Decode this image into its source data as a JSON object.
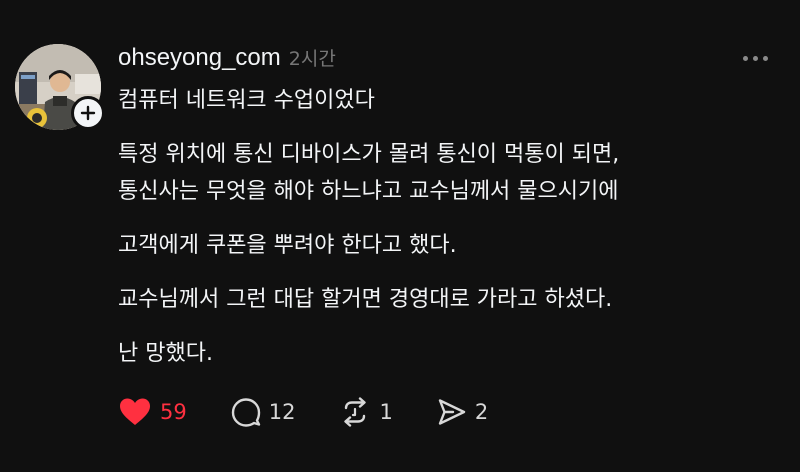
{
  "post": {
    "username": "ohseyong_com",
    "time": "2시간",
    "lines": [
      "컴퓨터 네트워크 수업이었다",
      "특정 위치에 통신 디바이스가 몰려 통신이 먹통이 되면,",
      "통신사는 무엇을 해야 하느냐고 교수님께서 물으시기에",
      "고객에게 쿠폰을 뿌려야 한다고 했다.",
      "교수님께서 그런 대답 할거면 경영대로 가라고 하셨다.",
      "난 망했다."
    ],
    "likes": "59",
    "comments": "12",
    "reposts": "1",
    "shares": "2"
  },
  "colors": {
    "background": "#101010",
    "like": "#ff3040",
    "muted": "#777777"
  },
  "icons": [
    "follow-plus-icon",
    "more-icon",
    "heart-icon",
    "comment-icon",
    "repost-icon",
    "share-icon"
  ]
}
